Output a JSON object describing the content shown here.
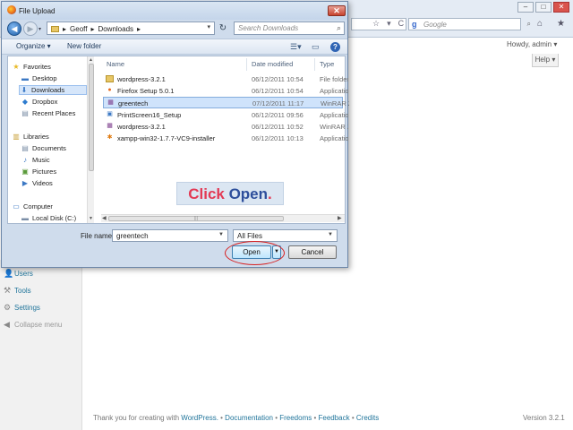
{
  "browser": {
    "search_placeholder": "Google",
    "search_engine_glyph": "g",
    "howdy": "Howdy, admin ▾",
    "help": "Help ▾"
  },
  "wordpress": {
    "menu": [
      {
        "label": "Users",
        "icon": "users-icon"
      },
      {
        "label": "Tools",
        "icon": "tools-icon"
      },
      {
        "label": "Settings",
        "icon": "settings-icon"
      },
      {
        "label": "Collapse menu",
        "icon": "collapse-icon"
      }
    ],
    "footer": {
      "thanks": "Thank you for creating with ",
      "wp_link": "WordPress.",
      "sep": " • ",
      "documentation": "Documentation",
      "freedoms": "Freedoms",
      "feedback": "Feedback",
      "credits": "Credits",
      "version": "Version 3.2.1"
    }
  },
  "dialog": {
    "title": "File Upload",
    "address": {
      "crumbs": [
        "Geoff",
        "Downloads"
      ],
      "separator": "▸"
    },
    "search_placeholder": "Search Downloads",
    "toolbar": {
      "organize": "Organize ▾",
      "new_folder": "New folder"
    },
    "nav": {
      "favorites": "Favorites",
      "desktop": "Desktop",
      "downloads": "Downloads",
      "dropbox": "Dropbox",
      "recent": "Recent Places",
      "libraries": "Libraries",
      "documents": "Documents",
      "music": "Music",
      "pictures": "Pictures",
      "videos": "Videos",
      "computer": "Computer",
      "local_disk": "Local Disk (C:)"
    },
    "columns": {
      "name": "Name",
      "date": "Date modified",
      "type": "Type"
    },
    "files": [
      {
        "name": "wordpress-3.2.1",
        "date": "06/12/2011 10:54",
        "type": "File folder",
        "icon": "folder-icon"
      },
      {
        "name": "Firefox Setup 5.0.1",
        "date": "06/12/2011 10:54",
        "type": "Application",
        "icon": "firefox-setup-icon"
      },
      {
        "name": "greentech",
        "date": "07/12/2011 11:17",
        "type": "WinRAR ZIP archive",
        "icon": "zip-archive-icon",
        "selected": true
      },
      {
        "name": "PrintScreen16_Setup",
        "date": "06/12/2011 09:56",
        "type": "Application",
        "icon": "app-icon"
      },
      {
        "name": "wordpress-3.2.1",
        "date": "06/12/2011 10:52",
        "type": "WinRAR ZIP archive",
        "icon": "zip-archive-icon"
      },
      {
        "name": "xampp-win32-1.7.7-VC9-installer",
        "date": "06/12/2011 10:13",
        "type": "Application",
        "icon": "xampp-icon"
      }
    ],
    "callout": {
      "word1": "Click ",
      "word2": "Open",
      "word3": "."
    },
    "filename_label": "File name:",
    "filename_value": "greentech",
    "filter_value": "All Files",
    "open": "Open",
    "cancel": "Cancel"
  }
}
